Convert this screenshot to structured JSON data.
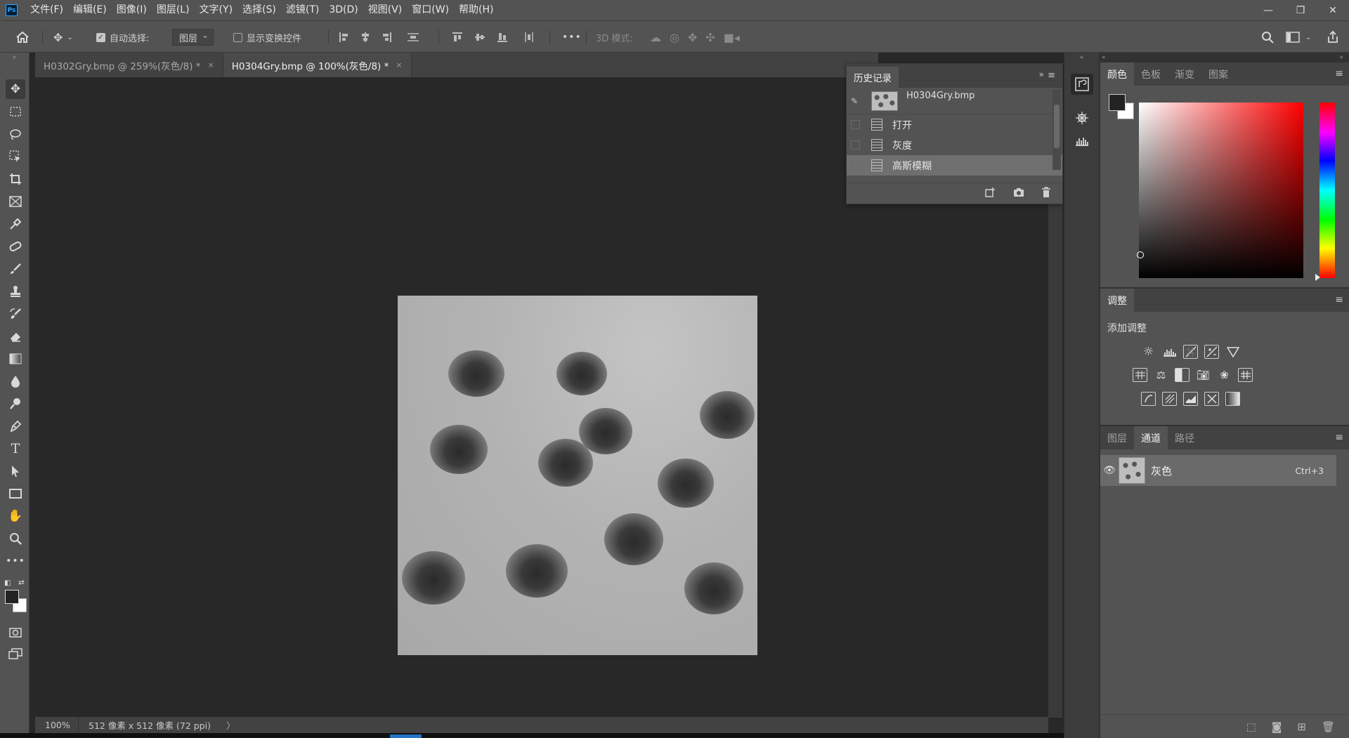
{
  "app": {
    "logo": "Ps",
    "menu": [
      "文件(F)",
      "编辑(E)",
      "图像(I)",
      "图层(L)",
      "文字(Y)",
      "选择(S)",
      "滤镜(T)",
      "3D(D)",
      "视图(V)",
      "窗口(W)",
      "帮助(H)"
    ],
    "window_controls": {
      "minimize": "—",
      "restore": "❐",
      "close": "✕"
    }
  },
  "options": {
    "auto_select_label": "自动选择:",
    "auto_select_checked": true,
    "auto_select_target": "图层",
    "show_transform_label": "显示变换控件",
    "show_transform_checked": false,
    "more": "•••",
    "mode_3d_label": "3D 模式:"
  },
  "tabs": [
    {
      "label": "H0302Gry.bmp @ 259%(灰色/8) *",
      "active": false,
      "close": "×"
    },
    {
      "label": "H0304Gry.bmp @ 100%(灰色/8) *",
      "active": true,
      "close": "×"
    }
  ],
  "status": {
    "zoom": "100%",
    "doc_info": "512 像素 x 512 像素 (72 ppi)",
    "arrow": "〉"
  },
  "history": {
    "tab_label": "历史记录",
    "snapshot_name": "H0304Gry.bmp",
    "items": [
      {
        "label": "打开",
        "selected": false
      },
      {
        "label": "灰度",
        "selected": false
      },
      {
        "label": "高斯模糊",
        "selected": true
      }
    ]
  },
  "color_panel": {
    "tabs": [
      "颜色",
      "色板",
      "渐变",
      "图案"
    ],
    "foreground": "#232323",
    "background": "#ffffff",
    "hue": "#ff0000"
  },
  "adjustments": {
    "tab_label": "调整",
    "title": "添加调整",
    "icons_row1": [
      "brightness-icon",
      "levels-icon",
      "curves-icon",
      "exposure-icon",
      "vibrance-icon"
    ],
    "icons_row2": [
      "hsl-icon",
      "color-balance-icon",
      "black-white-icon",
      "photo-filter-icon",
      "channel-mixer-icon",
      "color-lookup-icon"
    ],
    "icons_row3": [
      "invert-icon",
      "posterize-icon",
      "threshold-icon",
      "selective-color-icon",
      "gradient-map-icon"
    ]
  },
  "channels_panel": {
    "tabs": [
      "图层",
      "通道",
      "路径"
    ],
    "active_tab": "通道",
    "channel": {
      "name": "灰色",
      "shortcut": "Ctrl+3"
    }
  }
}
